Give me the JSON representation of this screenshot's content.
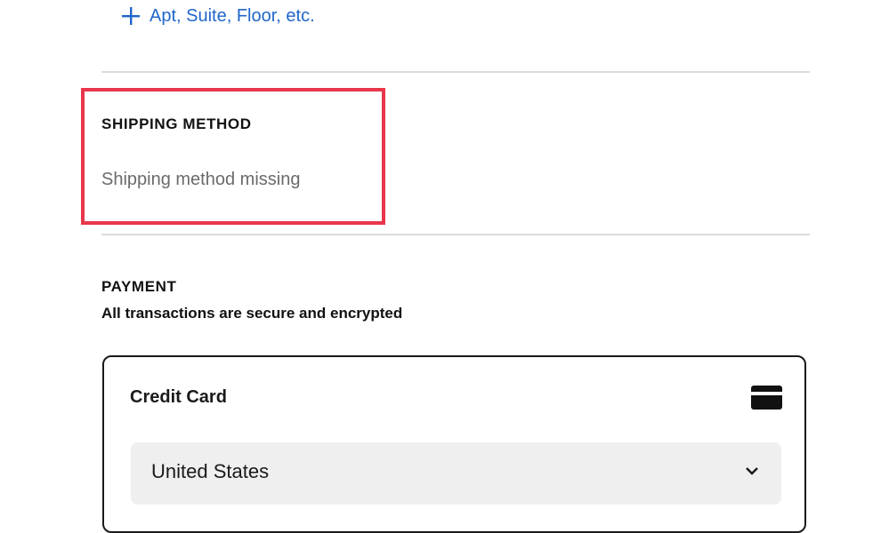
{
  "address": {
    "add_line_label": "Apt, Suite, Floor, etc.",
    "add_icon": "plus-icon"
  },
  "shipping": {
    "heading": "SHIPPING METHOD",
    "empty_text": "Shipping method missing",
    "highlight_color": "#e8364a"
  },
  "payment": {
    "heading": "PAYMENT",
    "subtitle": "All transactions are secure and encrypted",
    "method": {
      "title": "Credit Card",
      "icon": "credit-card-icon"
    },
    "country": {
      "selected": "United States",
      "icon": "chevron-down-icon"
    }
  },
  "colors": {
    "link": "#1f66c9",
    "divider": "#dcdcdc",
    "muted_text": "#6b6b6b",
    "field_bg": "#efefef"
  }
}
